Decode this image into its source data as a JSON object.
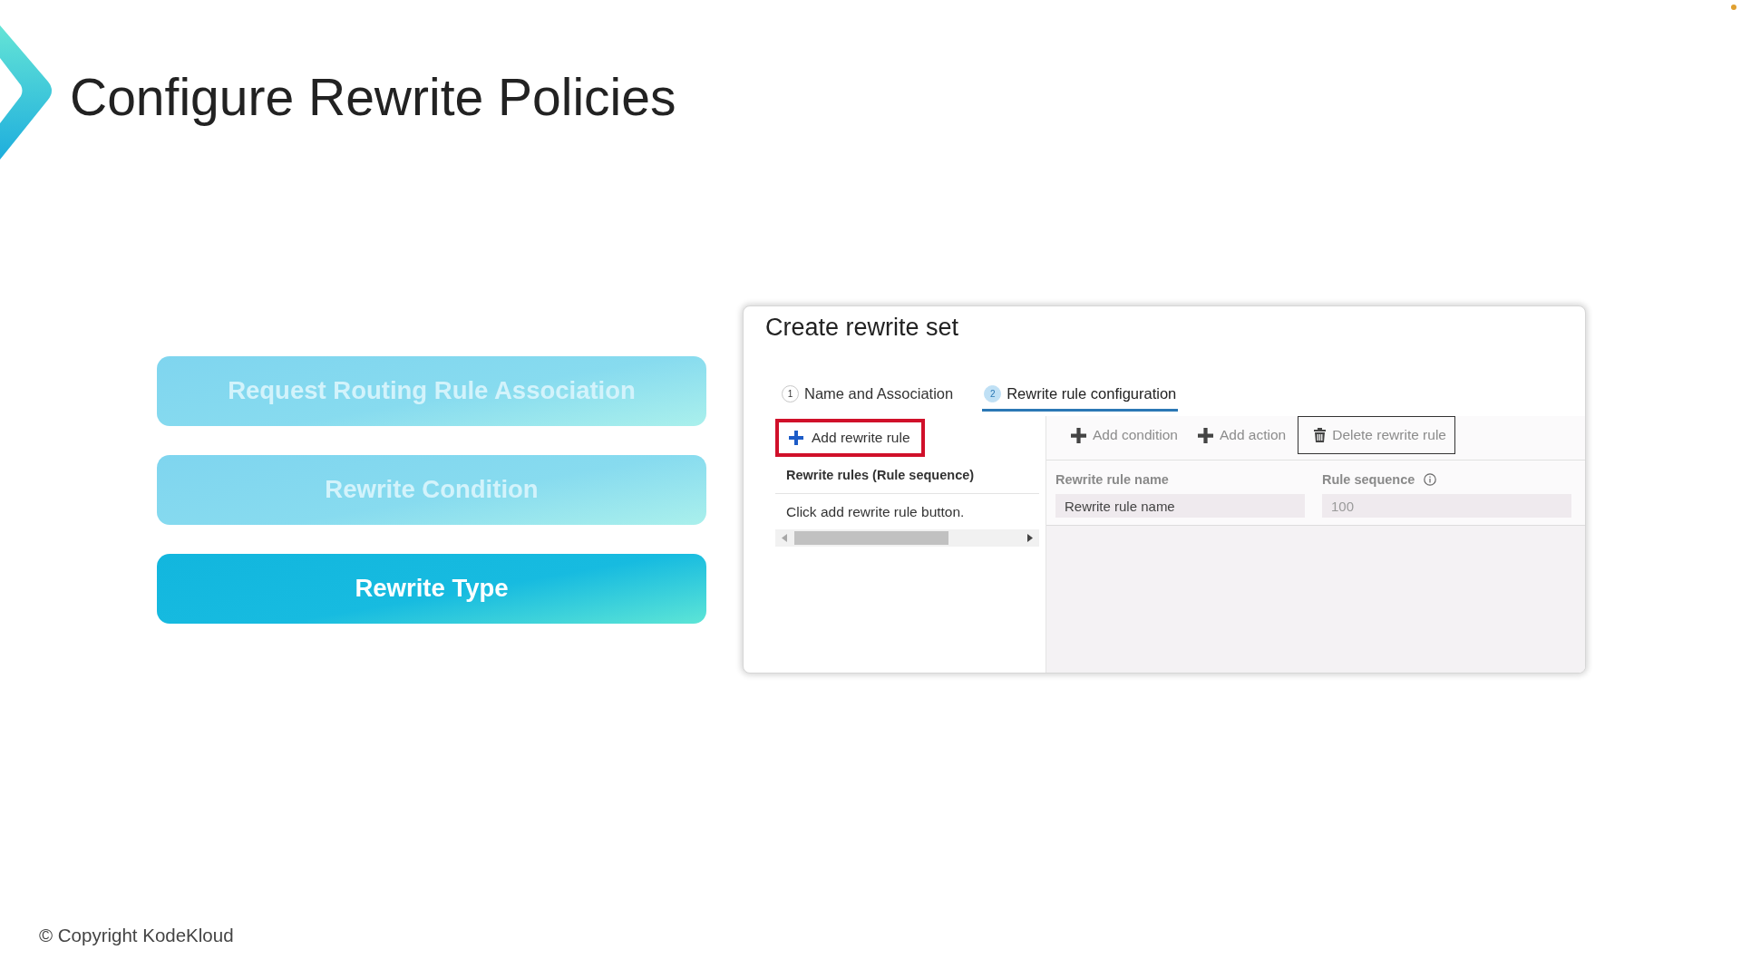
{
  "slide": {
    "title": "Configure Rewrite Policies"
  },
  "topics": [
    {
      "label": "Request Routing Rule Association",
      "selected": false
    },
    {
      "label": "Rewrite Condition",
      "selected": false
    },
    {
      "label": "Rewrite Type",
      "selected": true
    }
  ],
  "panel": {
    "title": "Create rewrite set",
    "tabs": [
      {
        "number": "1",
        "label": "Name and Association",
        "selected": false
      },
      {
        "number": "2",
        "label": "Rewrite rule configuration",
        "selected": true
      }
    ],
    "add_button": {
      "label": "Add rewrite rule",
      "highlighted": true
    },
    "rules_list": {
      "header": "Rewrite rules (Rule sequence)",
      "empty_text": "Click add rewrite rule button."
    },
    "toolbar": [
      {
        "kind": "add",
        "label": "Add condition",
        "disabled": true,
        "focused": false
      },
      {
        "kind": "add",
        "label": "Add action",
        "disabled": true,
        "focused": false
      },
      {
        "kind": "delete",
        "label": "Delete rewrite rule",
        "disabled": true,
        "focused": true
      }
    ],
    "fields": [
      {
        "label": "Rewrite rule name",
        "value": "Rewrite rule name",
        "disabled": false,
        "info": false
      },
      {
        "label": "Rule sequence",
        "value": "100",
        "disabled": true,
        "info": true
      }
    ]
  },
  "footer": {
    "copyright": "© Copyright KodeKloud"
  }
}
